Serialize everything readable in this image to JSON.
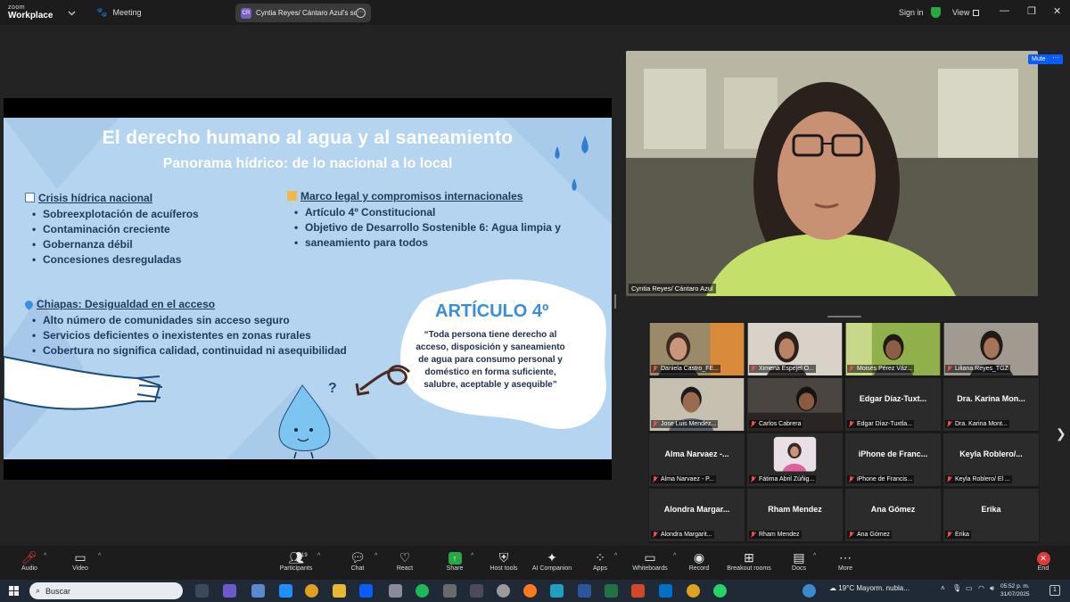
{
  "titlebar": {
    "logo_line1": "zoom",
    "logo_line2": "Workplace",
    "tab_meeting": "Meeting",
    "tab_share_badge": "CR",
    "tab_share_title": "Cyntia Reyes/ Cántaro Azul's scre",
    "sign_in": "Sign in",
    "view": "View"
  },
  "slide": {
    "title": "El derecho humano al agua y al saneamiento",
    "subtitle": "Panorama hídrico: de lo nacional a lo local",
    "section1": {
      "heading": "Crisis hídrica nacional",
      "items": [
        "Sobreexplotación de acuíferos",
        "Contaminación creciente",
        "Gobernanza débil",
        "Concesiones desreguladas"
      ]
    },
    "section2": {
      "heading": "Marco legal y compromisos internacionales",
      "items": [
        "Artículo 4º Constitucional",
        "Objetivo de Desarrollo Sostenible 6: Agua limpia y",
        "saneamiento para todos"
      ]
    },
    "section3": {
      "heading": "Chiapas: Desigualdad en el acceso",
      "items": [
        "Alto número de comunidades sin acceso seguro",
        "Servicios deficientes o inexistentes en zonas rurales",
        "Cobertura no significa calidad, continuidad ni asequibilidad"
      ]
    },
    "article_title": "ARTÍCULO 4º",
    "article_quote": "“Toda persona tiene derecho al acceso, disposición y saneamiento de agua para consumo personal y doméstico en forma suficiente, salubre, aceptable y asequible”",
    "question_mark": "?"
  },
  "speaker": {
    "name": "Cyntia Reyes/ Cántaro Azul",
    "mute_label": "Mute",
    "more_label": "···"
  },
  "gallery": {
    "tiles": [
      {
        "big": "",
        "label": "Daniela Castro_FE..."
      },
      {
        "big": "",
        "label": "Ximena Espejel O..."
      },
      {
        "big": "",
        "label": "Moisés Pérez Váz..."
      },
      {
        "big": "",
        "label": "Liliana Reyes_TGZ"
      },
      {
        "big": "",
        "label": "Jose Luis Mendez..."
      },
      {
        "big": "",
        "label": "Carlos Cabrera"
      },
      {
        "big": "Edgar Díaz-Tuxt...",
        "label": "Edgar Díaz-Tuxtla..."
      },
      {
        "big": "Dra. Karina Mon...",
        "label": "Dra. Karina Mont..."
      },
      {
        "big": "Alma Narvaez -...",
        "label": "Alma Narvaez - P..."
      },
      {
        "big": "",
        "label": "Fátima Abril Zúñig..."
      },
      {
        "big": "iPhone de Franc...",
        "label": "iPhone de Francis..."
      },
      {
        "big": "Keyla Roblero/...",
        "label": "Keyla Roblero/ El ..."
      },
      {
        "big": "Alondra Margar...",
        "label": "Alondra Margarit..."
      },
      {
        "big": "Rham Mendez",
        "label": "Rham Mendez"
      },
      {
        "big": "Ana Gómez",
        "label": "Ana Gómez"
      },
      {
        "big": "Erika",
        "label": "Erika"
      }
    ]
  },
  "toolbar": {
    "audio": "Audio",
    "video": "Video",
    "participants": "Participants",
    "participants_count": "19",
    "chat": "Chat",
    "react": "React",
    "share": "Share",
    "host_tools": "Host tools",
    "ai_companion": "AI Companion",
    "apps": "Apps",
    "whiteboards": "Whiteboards",
    "record": "Record",
    "breakout_rooms": "Breakout rooms",
    "docs": "Docs",
    "more": "More",
    "end": "End"
  },
  "taskbar": {
    "search_placeholder": "Buscar",
    "weather": "19°C  Mayorm. nubla...",
    "time": "05:52 p. m.",
    "date": "31/07/2025",
    "notification_count": "1"
  }
}
